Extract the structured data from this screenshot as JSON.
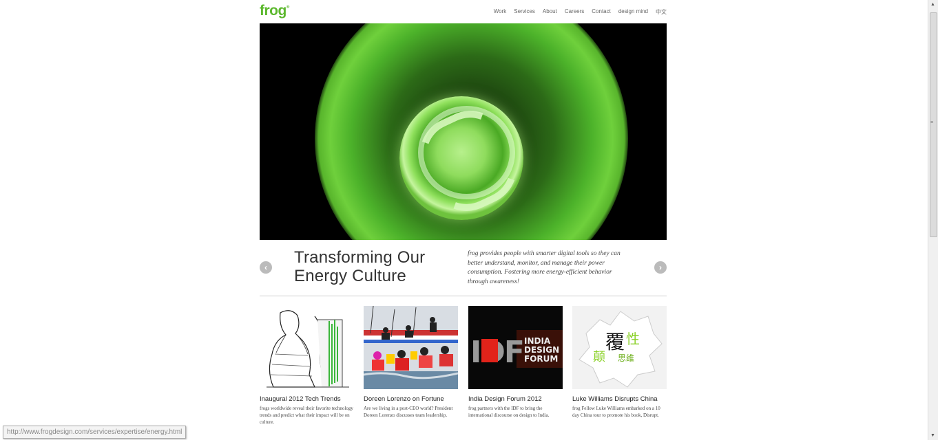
{
  "header": {
    "logo": "frog",
    "nav": [
      "Work",
      "Services",
      "About",
      "Careers",
      "Contact",
      "design mind",
      "中文"
    ]
  },
  "feature": {
    "title_line1": "Transforming Our",
    "title_line2": "Energy Culture",
    "description": "frog provides people with smarter digital tools so they can better understand, monitor, and manage their power consumption. Fostering more energy-efficient behavior through awareness!",
    "prev_icon": "chevron-left-icon",
    "next_icon": "chevron-right-icon",
    "accent_color": "#5cb82e"
  },
  "cards": [
    {
      "title": "Inaugural 2012 Tech Trends",
      "text": "frogs worldwide reveal their favorite technology trends and predict what their impact will be on culture."
    },
    {
      "title": "Doreen Lorenzo on Fortune",
      "text": "Are we living in a post-CEO world? President Doreen Lorenzo discusses team leadership."
    },
    {
      "title": "India Design Forum 2012",
      "text": "frog partners with the IDF to bring the international discourse on design to India.",
      "image_text_big": "IDF",
      "image_text_lines": [
        "INDIA",
        "DESIGN",
        "FORUM"
      ]
    },
    {
      "title": "Luke Williams Disrupts China",
      "text": "frog Fellow Luke Williams embarked on a 10 day China tour to promote his book, Disrupt.",
      "image_text": [
        "覆",
        "性",
        "颠",
        "思维"
      ]
    }
  ],
  "status_bar": {
    "url": "http://www.frogdesign.com/services/expertise/energy.html"
  }
}
